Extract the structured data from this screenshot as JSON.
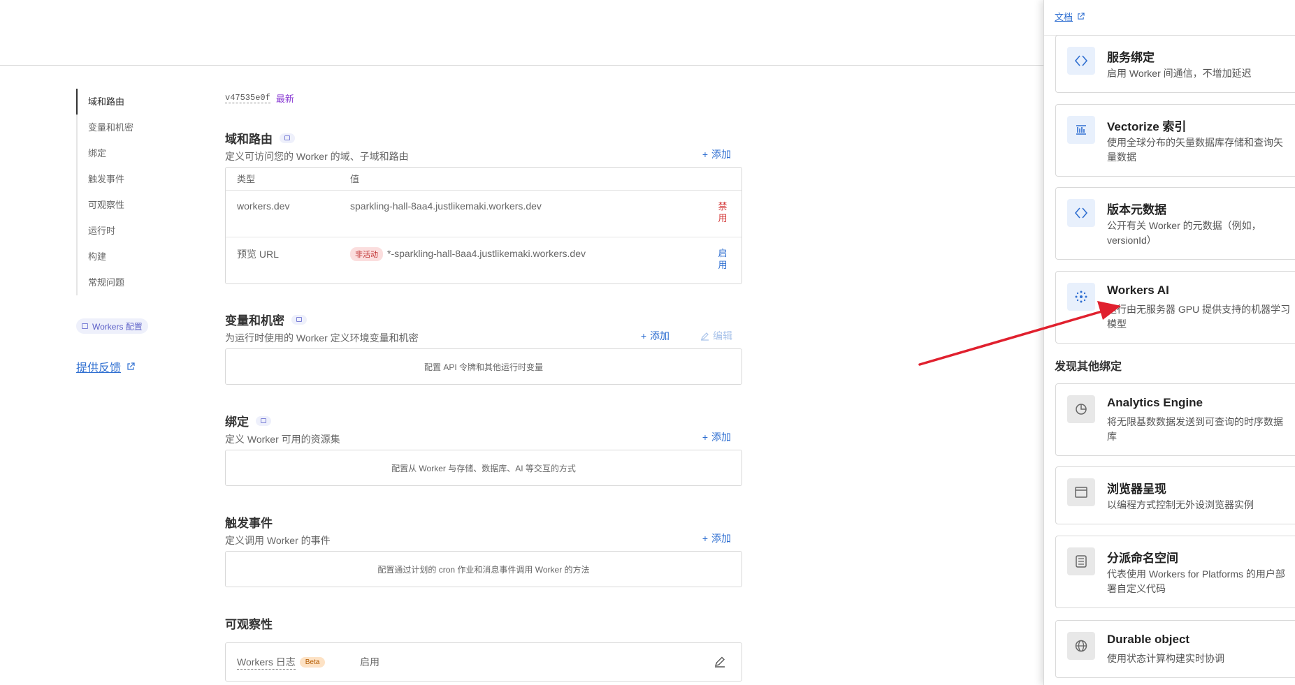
{
  "nav": {
    "items": [
      "域和路由",
      "变量和机密",
      "绑定",
      "触发事件",
      "可观察性",
      "运行时",
      "构建",
      "常规问题"
    ],
    "config_chip": "Workers 配置",
    "feedback": "提供反馈"
  },
  "version": {
    "id": "v47535e0f",
    "tag": "最新"
  },
  "routes": {
    "title": "域和路由",
    "subtitle": "定义可访问您的 Worker 的域、子域和路由",
    "add": "添加",
    "headers": [
      "类型",
      "值"
    ],
    "rows": [
      {
        "type": "workers.dev",
        "value": "sparkling-hall-8aa4.justlikemaki.workers.dev",
        "action": "禁用"
      },
      {
        "type": "预览 URL",
        "badge": "非活动",
        "value": "*-sparkling-hall-8aa4.justlikemaki.workers.dev",
        "action": "启用"
      }
    ]
  },
  "vars": {
    "title": "变量和机密",
    "subtitle": "为运行时使用的 Worker 定义环境变量和机密",
    "add": "添加",
    "edit": "编辑",
    "empty": "配置 API 令牌和其他运行时变量"
  },
  "bindings": {
    "title": "绑定",
    "subtitle": "定义 Worker 可用的资源集",
    "add": "添加",
    "empty": "配置从 Worker 与存储、数据库、AI 等交互的方式"
  },
  "triggers": {
    "title": "触发事件",
    "subtitle": "定义调用 Worker 的事件",
    "add": "添加",
    "empty": "配置通过计划的 cron 作业和消息事件调用 Worker 的方法"
  },
  "observability": {
    "title": "可观察性",
    "row_label": "Workers 日志",
    "badge": "Beta",
    "status": "启用"
  },
  "panel": {
    "doc_link": "文档",
    "cards": [
      {
        "title": "服务绑定",
        "desc": "启用 Worker 间通信，不增加延迟",
        "icon": "service-binding-icon"
      },
      {
        "title": "Vectorize 索引",
        "desc": "使用全球分布的矢量数据库存储和查询矢量数据",
        "icon": "vectorize-icon"
      },
      {
        "title": "版本元数据",
        "desc": "公开有关 Worker 的元数据（例如，versionId）",
        "icon": "version-metadata-icon"
      },
      {
        "title": "Workers AI",
        "desc": "运行由无服务器 GPU 提供支持的机器学习模型",
        "icon": "workers-ai-icon"
      }
    ],
    "discover_title": "发现其他绑定",
    "other_cards": [
      {
        "title": "Analytics Engine",
        "desc": "将无限基数数据发送到可查询的时序数据库",
        "icon": "analytics-engine-icon"
      },
      {
        "title": "浏览器呈现",
        "desc": "以编程方式控制无外设浏览器实例",
        "icon": "browser-rendering-icon"
      },
      {
        "title": "分派命名空间",
        "desc": "代表使用 Workers for Platforms 的用户部署自定义代码",
        "icon": "dispatch-namespace-icon"
      },
      {
        "title": "Durable object",
        "desc": "使用状态计算构建实时协调",
        "icon": "durable-object-icon"
      }
    ]
  },
  "colors": {
    "accent": "#2f6fd1",
    "danger": "#d43a3a",
    "annotation_arrow": "#e0202e"
  }
}
